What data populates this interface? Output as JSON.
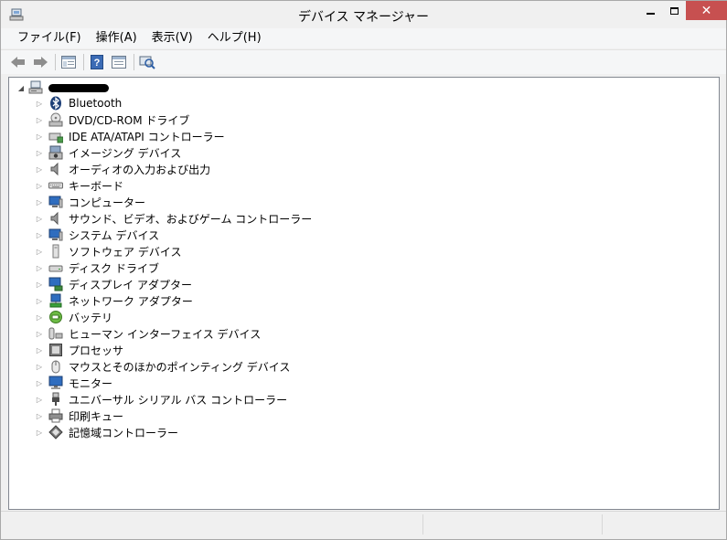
{
  "window": {
    "title": "デバイス マネージャー",
    "close_glyph": "✕"
  },
  "menu": [
    {
      "label": "ファイル(F)"
    },
    {
      "label": "操作(A)"
    },
    {
      "label": "表示(V)"
    },
    {
      "label": "ヘルプ(H)"
    }
  ],
  "toolbar": {
    "buttons": [
      "back-icon",
      "forward-icon",
      "properties-pane-icon",
      "help-icon",
      "view-icon",
      "scan-hardware-icon"
    ]
  },
  "tree": {
    "root_expanded_glyph": "◢",
    "collapsed_glyph": "▷",
    "categories": [
      {
        "label": "Bluetooth",
        "icon": "bluetooth-icon"
      },
      {
        "label": "DVD/CD-ROM ドライブ",
        "icon": "dvd-drive-icon"
      },
      {
        "label": "IDE ATA/ATAPI コントローラー",
        "icon": "ide-controller-icon"
      },
      {
        "label": "イメージング デバイス",
        "icon": "camera-icon"
      },
      {
        "label": "オーディオの入力および出力",
        "icon": "speaker-icon"
      },
      {
        "label": "キーボード",
        "icon": "keyboard-icon"
      },
      {
        "label": "コンピューター",
        "icon": "computer-icon"
      },
      {
        "label": "サウンド、ビデオ、およびゲーム コントローラー",
        "icon": "sound-icon"
      },
      {
        "label": "システム デバイス",
        "icon": "system-device-icon"
      },
      {
        "label": "ソフトウェア デバイス",
        "icon": "software-device-icon"
      },
      {
        "label": "ディスク ドライブ",
        "icon": "disk-drive-icon"
      },
      {
        "label": "ディスプレイ アダプター",
        "icon": "display-adapter-icon"
      },
      {
        "label": "ネットワーク アダプター",
        "icon": "network-adapter-icon"
      },
      {
        "label": "バッテリ",
        "icon": "battery-icon"
      },
      {
        "label": "ヒューマン インターフェイス デバイス",
        "icon": "hid-icon"
      },
      {
        "label": "プロセッサ",
        "icon": "processor-icon"
      },
      {
        "label": "マウスとそのほかのポインティング デバイス",
        "icon": "mouse-icon"
      },
      {
        "label": "モニター",
        "icon": "monitor-icon"
      },
      {
        "label": "ユニバーサル シリアル バス コントローラー",
        "icon": "usb-icon"
      },
      {
        "label": "印刷キュー",
        "icon": "printer-icon"
      },
      {
        "label": "記憶域コントローラー",
        "icon": "storage-controller-icon"
      }
    ]
  }
}
